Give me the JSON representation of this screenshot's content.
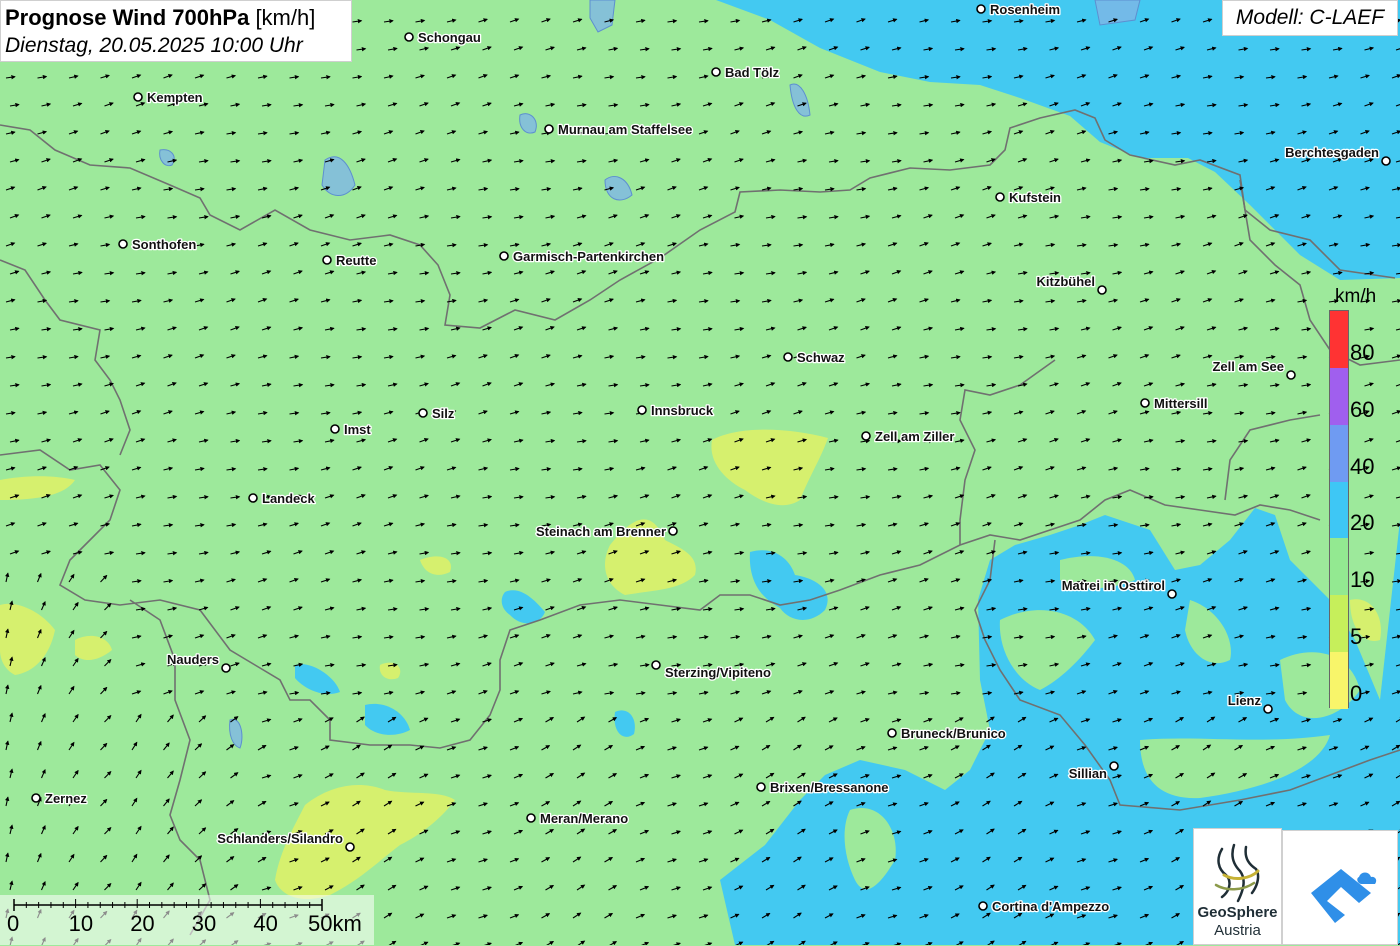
{
  "title": {
    "main": "Prognose Wind 700hPa",
    "unit": "[km/h]",
    "date": "Dienstag, 20.05.2025 10:00 Uhr"
  },
  "model": "Modell: C-LAEF",
  "legend": {
    "unit": "km/h",
    "labels": [
      "80",
      "60",
      "40",
      "20",
      "10",
      "5",
      "0"
    ],
    "colors": [
      "#ff3333",
      "#a05fee",
      "#6f9bf2",
      "#3ec7f5",
      "#93e991",
      "#c6ef5b",
      "#f8f56a"
    ]
  },
  "scale_bar": {
    "labels": [
      "0",
      "10",
      "20",
      "30",
      "40",
      "50km"
    ]
  },
  "logos": {
    "geosphere_line1": "GeoSphere",
    "geosphere_line2": "Austria"
  },
  "colors": {
    "field_green": "#9de99b",
    "field_blue": "#3ec7f5",
    "field_yellow": "#d9f06c"
  },
  "cities": [
    {
      "name": "Rosenheim"
    },
    {
      "name": "Schongau"
    },
    {
      "name": "Bad Tölz"
    },
    {
      "name": "Kempten"
    },
    {
      "name": "Murnau am Staffelsee"
    },
    {
      "name": "Berchtesgaden"
    },
    {
      "name": "Kufstein"
    },
    {
      "name": "Sonthofen"
    },
    {
      "name": "Reutte"
    },
    {
      "name": "Garmisch-Partenkirchen"
    },
    {
      "name": "Kitzbühel"
    },
    {
      "name": "Schwaz"
    },
    {
      "name": "Zell am See"
    },
    {
      "name": "Mittersill"
    },
    {
      "name": "Silz"
    },
    {
      "name": "Innsbruck"
    },
    {
      "name": "Imst"
    },
    {
      "name": "Zell am Ziller"
    },
    {
      "name": "Landeck"
    },
    {
      "name": "Steinach am Brenner"
    },
    {
      "name": "Matrei in Osttirol"
    },
    {
      "name": "Nauders"
    },
    {
      "name": "Sterzing/Vipiteno"
    },
    {
      "name": "Lienz"
    },
    {
      "name": "Bruneck/Brunico"
    },
    {
      "name": "Sillian"
    },
    {
      "name": "Brixen/Bressanone"
    },
    {
      "name": "Zernez"
    },
    {
      "name": "Meran/Merano"
    },
    {
      "name": "Schlanders/Silandro"
    },
    {
      "name": "Cortina d'Ampezzo"
    }
  ]
}
